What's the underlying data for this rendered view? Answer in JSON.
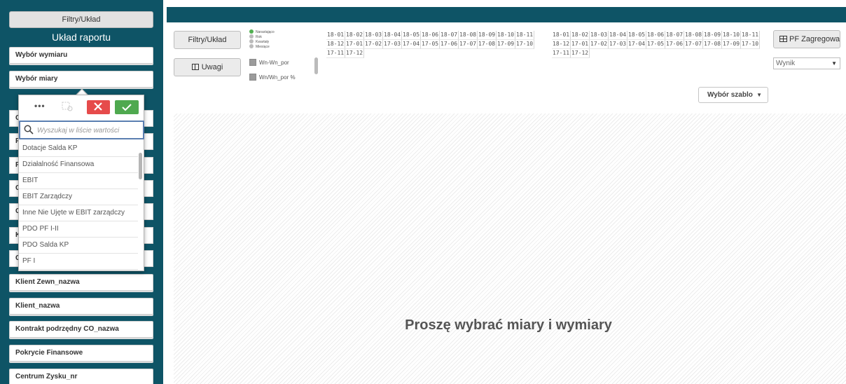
{
  "sidebar": {
    "top_button": "Filtry/Układ",
    "title": "Układ raportu",
    "items": [
      "Wybór wymiaru",
      "Wybór miary",
      "Klient Zewn_nazwa",
      "Klient_nazwa",
      "Kontrakt podrzędny CO_nazwa",
      "Pokrycie Finansowe",
      "Centrum Zysku_nr"
    ],
    "partial_items": [
      "G",
      "P",
      "R",
      "C",
      "C",
      "K",
      "C"
    ]
  },
  "popup": {
    "more_label": "•••",
    "search_placeholder": "Wyszukaj w liście wartości",
    "options": [
      "Dotacje Salda KP",
      "Działalność Finansowa",
      "EBIT",
      "EBIT Zarządczy",
      "Inne Nie Ujęte w EBIT zarządczy",
      "PDO PF I-II",
      "PDO Salda KP",
      "PF I"
    ]
  },
  "toolbar": {
    "filtry_label": "Filtry/Układ",
    "uwagi_label": "Uwagi",
    "radio_options": [
      {
        "label": "Narastająco",
        "selected": true
      },
      {
        "label": "Rok",
        "selected": false
      },
      {
        "label": "Kwartały",
        "selected": false
      },
      {
        "label": "Miesiące",
        "selected": false
      }
    ],
    "checkboxes": [
      "Wn-Wn_por",
      "Wn/Wn_por %"
    ],
    "dates_left": [
      "18-01",
      "18-02",
      "18-03",
      "18-04",
      "18-05",
      "18-06",
      "18-07",
      "18-08",
      "18-09",
      "18-10",
      "18-11",
      "18-12",
      "17-01",
      "17-02",
      "17-03",
      "17-04",
      "17-05",
      "17-06",
      "17-07",
      "17-08",
      "17-09",
      "17-10",
      "17-11",
      "17-12"
    ],
    "dates_right": [
      "18-01",
      "18-02",
      "18-03",
      "18-04",
      "18-05",
      "18-06",
      "18-07",
      "18-08",
      "18-09",
      "18-10",
      "18-11",
      "18-12",
      "17-01",
      "17-02",
      "17-03",
      "17-04",
      "17-05",
      "17-06",
      "17-07",
      "17-08",
      "17-09",
      "17-10",
      "17-11",
      "17-12"
    ],
    "pf_label": "PF Zagregowany",
    "wynik_value": "Wynik",
    "szablon_label": "Wybór szablo"
  },
  "main": {
    "message": "Proszę wybrać miary i wymiary"
  },
  "colors": {
    "sidebar_bg": "#0e5466",
    "cancel": "#e64b4b",
    "confirm": "#4fa94f",
    "search_border": "#5b7fb1",
    "radio_selected": "#52b052"
  }
}
